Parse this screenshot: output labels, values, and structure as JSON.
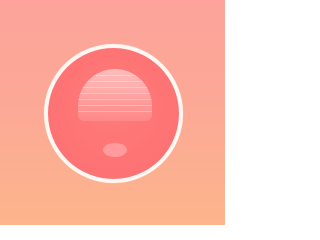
{
  "icon": {
    "name": "red-sphere-button-icon",
    "colors": {
      "background_top": "#FDA39B",
      "background_bottom": "#FDB58C",
      "ring": "#FFF7F2",
      "sphere": "#FE7474",
      "highlight": "#FFB2B0",
      "reflection": "#FFA0A2"
    }
  }
}
